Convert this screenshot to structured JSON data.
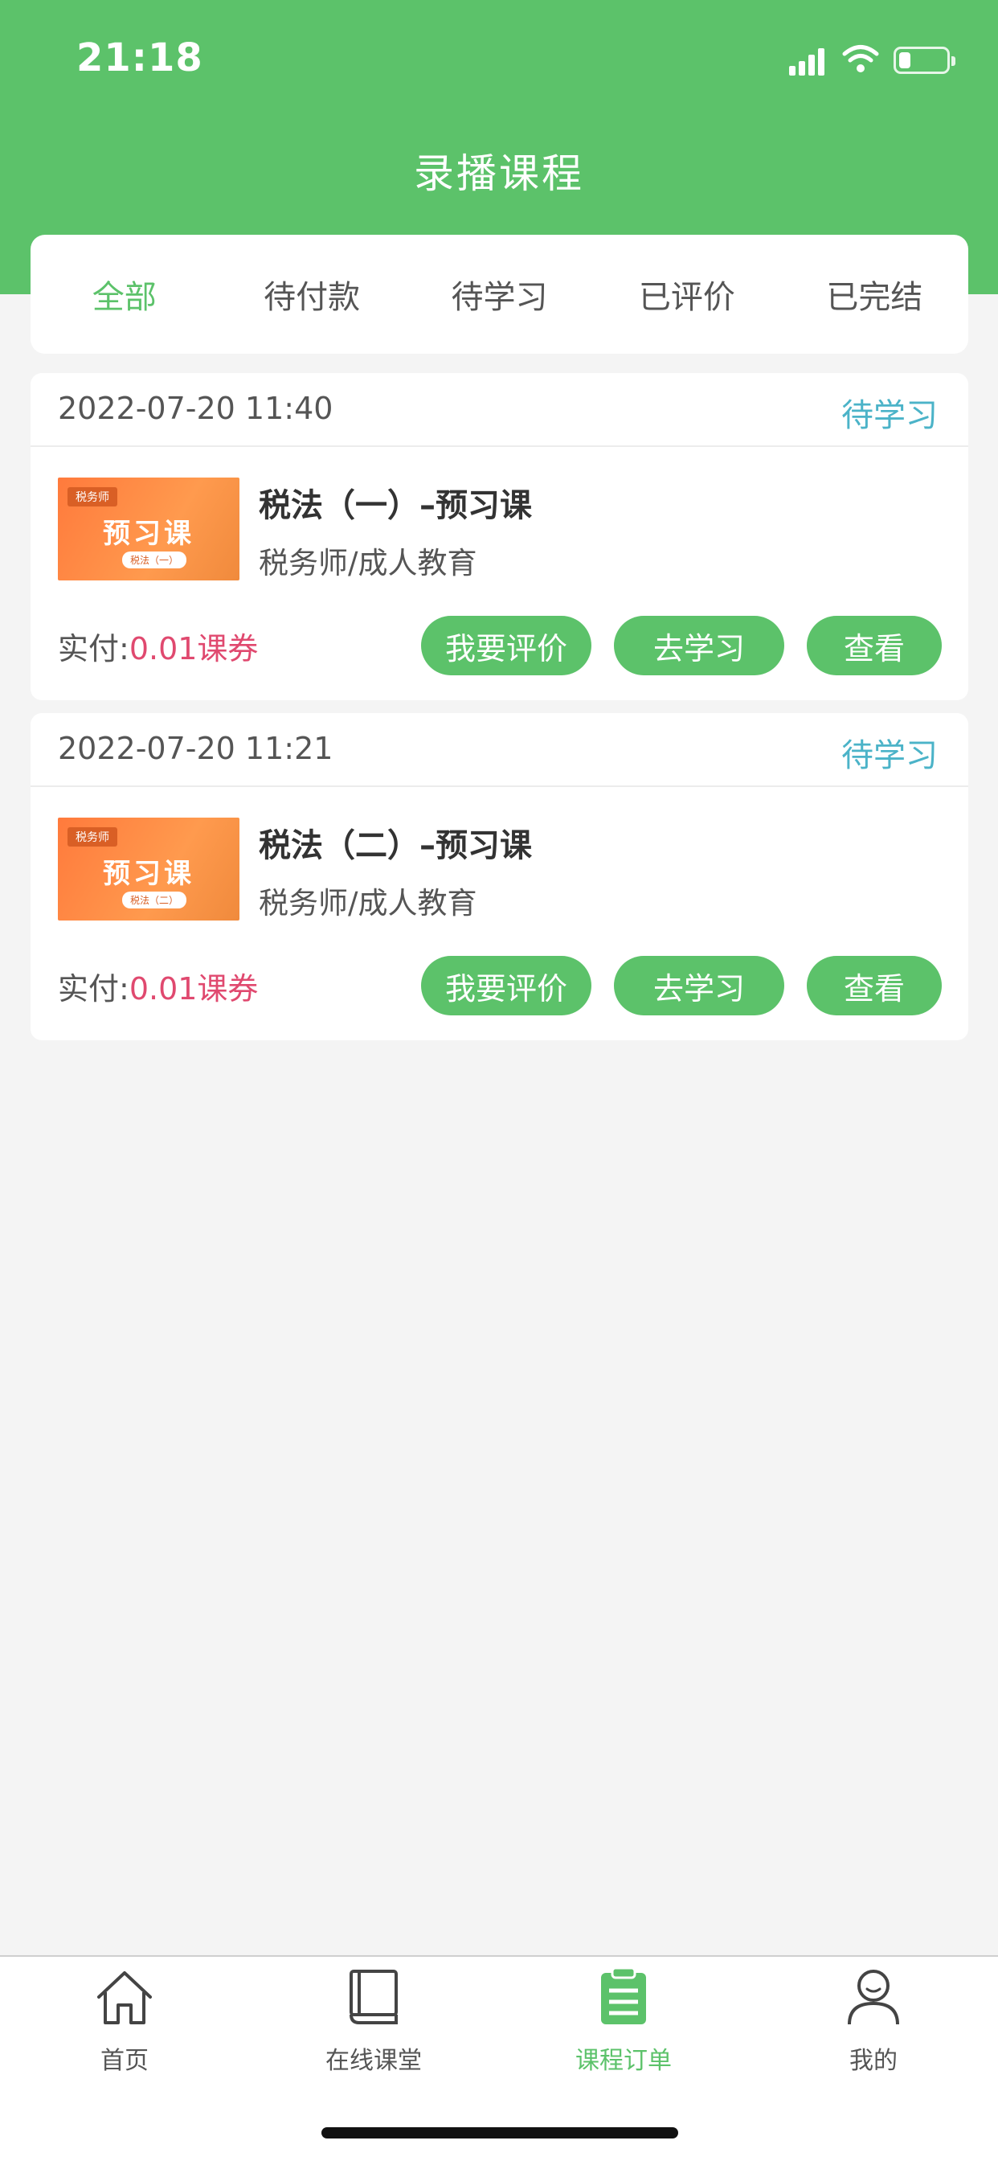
{
  "status_bar": {
    "time": "21:18"
  },
  "header": {
    "title": "录播课程"
  },
  "tabs": [
    {
      "label": "全部",
      "active": true
    },
    {
      "label": "待付款",
      "active": false
    },
    {
      "label": "待学习",
      "active": false
    },
    {
      "label": "已评价",
      "active": false
    },
    {
      "label": "已完结",
      "active": false
    }
  ],
  "orders": [
    {
      "datetime": "2022-07-20 11:40",
      "status": "待学习",
      "thumbnail": {
        "tag": "税务师",
        "title": "预习课",
        "sub": "税法（一）"
      },
      "course_title": "税法（一）–预习课",
      "course_subtitle": "税务师/成人教育",
      "paid_label": "实付:",
      "paid_value": "0.01课券",
      "buttons": {
        "review": "我要评价",
        "study": "去学习",
        "view": "查看"
      }
    },
    {
      "datetime": "2022-07-20 11:21",
      "status": "待学习",
      "thumbnail": {
        "tag": "税务师",
        "title": "预习课",
        "sub": "税法（二）"
      },
      "course_title": "税法（二）–预习课",
      "course_subtitle": "税务师/成人教育",
      "paid_label": "实付:",
      "paid_value": "0.01课券",
      "buttons": {
        "review": "我要评价",
        "study": "去学习",
        "view": "查看"
      }
    }
  ],
  "tabbar": [
    {
      "label": "首页",
      "icon": "home-icon",
      "active": false
    },
    {
      "label": "在线课堂",
      "icon": "book-icon",
      "active": false
    },
    {
      "label": "课程订单",
      "icon": "clipboard-icon",
      "active": true
    },
    {
      "label": "我的",
      "icon": "user-icon",
      "active": false
    }
  ],
  "colors": {
    "primary_green": "#5cc26a",
    "status_blue": "#4bb3c8",
    "price_pink": "#e0496f",
    "background": "#f4f4f4"
  }
}
